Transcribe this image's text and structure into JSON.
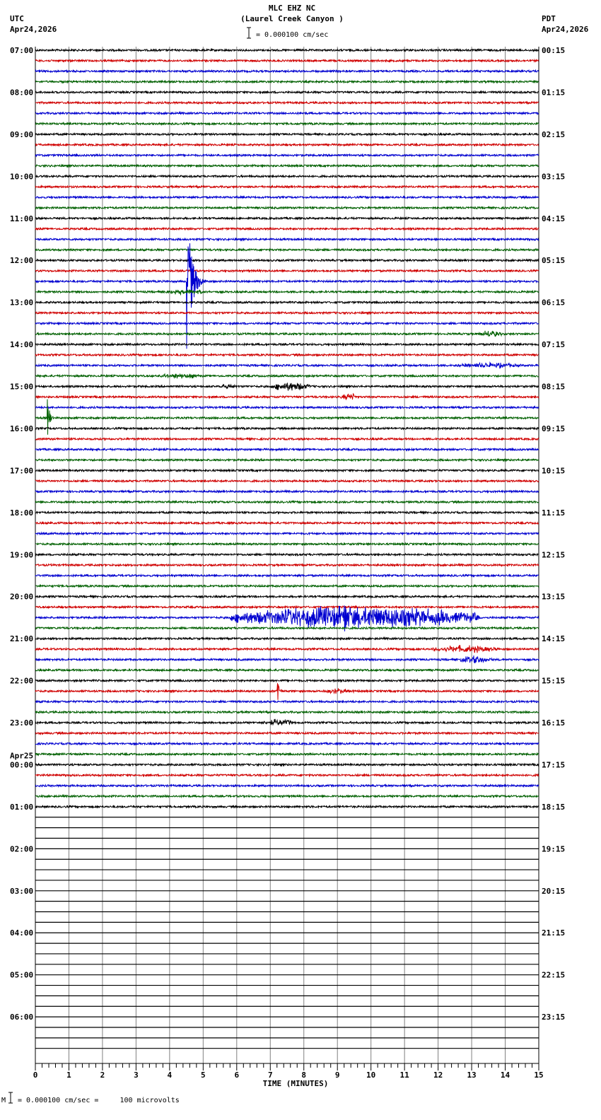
{
  "header": {
    "station": "MLC EHZ NC",
    "location": "(Laurel Creek Canyon )",
    "scale": "= 0.000100 cm/sec",
    "left_tz": "UTC",
    "left_date": "Apr24,2026",
    "right_tz": "PDT",
    "right_date": "Apr24,2026"
  },
  "footer": {
    "scale_note": "= 0.000100 cm/sec =     100 microvolts",
    "marker": "M"
  },
  "chart_data": {
    "type": "line",
    "title": "MLC EHZ NC (Laurel Creek Canyon )",
    "xlabel": "TIME (MINUTES)",
    "xlim": [
      0,
      15
    ],
    "x_ticks": [
      "0",
      "1",
      "2",
      "3",
      "4",
      "5",
      "6",
      "7",
      "8",
      "9",
      "10",
      "11",
      "12",
      "13",
      "14",
      "15"
    ],
    "traces_total": 96,
    "traces_with_data": 73,
    "trace_colors": [
      "#000000",
      "#d00000",
      "#0000d0",
      "#006000"
    ],
    "grid_color": "#808080",
    "left_labels": [
      {
        "row": 0,
        "text": "07:00"
      },
      {
        "row": 4,
        "text": "08:00"
      },
      {
        "row": 8,
        "text": "09:00"
      },
      {
        "row": 12,
        "text": "10:00"
      },
      {
        "row": 16,
        "text": "11:00"
      },
      {
        "row": 20,
        "text": "12:00"
      },
      {
        "row": 24,
        "text": "13:00"
      },
      {
        "row": 28,
        "text": "14:00"
      },
      {
        "row": 32,
        "text": "15:00"
      },
      {
        "row": 36,
        "text": "16:00"
      },
      {
        "row": 40,
        "text": "17:00"
      },
      {
        "row": 44,
        "text": "18:00"
      },
      {
        "row": 48,
        "text": "19:00"
      },
      {
        "row": 52,
        "text": "20:00"
      },
      {
        "row": 56,
        "text": "21:00"
      },
      {
        "row": 60,
        "text": "22:00"
      },
      {
        "row": 64,
        "text": "23:00"
      },
      {
        "row": 68,
        "text": "00:00",
        "date": "Apr25"
      },
      {
        "row": 72,
        "text": "01:00"
      },
      {
        "row": 76,
        "text": "02:00"
      },
      {
        "row": 80,
        "text": "03:00"
      },
      {
        "row": 84,
        "text": "04:00"
      },
      {
        "row": 88,
        "text": "05:00"
      },
      {
        "row": 92,
        "text": "06:00"
      }
    ],
    "right_labels": [
      {
        "row": 0,
        "text": "00:15"
      },
      {
        "row": 4,
        "text": "01:15"
      },
      {
        "row": 8,
        "text": "02:15"
      },
      {
        "row": 12,
        "text": "03:15"
      },
      {
        "row": 16,
        "text": "04:15"
      },
      {
        "row": 20,
        "text": "05:15"
      },
      {
        "row": 24,
        "text": "06:15"
      },
      {
        "row": 28,
        "text": "07:15"
      },
      {
        "row": 32,
        "text": "08:15"
      },
      {
        "row": 36,
        "text": "09:15"
      },
      {
        "row": 40,
        "text": "10:15"
      },
      {
        "row": 44,
        "text": "11:15"
      },
      {
        "row": 48,
        "text": "12:15"
      },
      {
        "row": 52,
        "text": "13:15"
      },
      {
        "row": 56,
        "text": "14:15"
      },
      {
        "row": 60,
        "text": "15:15"
      },
      {
        "row": 64,
        "text": "16:15"
      },
      {
        "row": 68,
        "text": "17:15"
      },
      {
        "row": 72,
        "text": "18:15"
      },
      {
        "row": 76,
        "text": "19:15"
      },
      {
        "row": 80,
        "text": "20:15"
      },
      {
        "row": 84,
        "text": "21:15"
      },
      {
        "row": 88,
        "text": "22:15"
      },
      {
        "row": 92,
        "text": "23:15"
      }
    ],
    "events": [
      {
        "row": 22,
        "start": 4.5,
        "end": 5.4,
        "amp": 110,
        "type": "spike"
      },
      {
        "row": 23,
        "start": 3.8,
        "end": 5.2,
        "amp": 3,
        "type": "burst"
      },
      {
        "row": 27,
        "start": 13.2,
        "end": 13.9,
        "amp": 4,
        "type": "burst"
      },
      {
        "row": 30,
        "start": 12.5,
        "end": 14.5,
        "amp": 3,
        "type": "burst"
      },
      {
        "row": 31,
        "start": 3.6,
        "end": 5.0,
        "amp": 3,
        "type": "burst"
      },
      {
        "row": 32,
        "start": 7.0,
        "end": 8.2,
        "amp": 5,
        "type": "burst"
      },
      {
        "row": 32,
        "start": 5.5,
        "end": 6.0,
        "amp": 3,
        "type": "burst"
      },
      {
        "row": 33,
        "start": 9.1,
        "end": 9.6,
        "amp": 4,
        "type": "burst"
      },
      {
        "row": 35,
        "start": 0.35,
        "end": 0.7,
        "amp": 40,
        "type": "spike"
      },
      {
        "row": 54,
        "start": 5.8,
        "end": 13.2,
        "amp": 12,
        "type": "burst"
      },
      {
        "row": 54,
        "start": 9.2,
        "end": 9.7,
        "amp": 40,
        "type": "spike"
      },
      {
        "row": 57,
        "start": 11.8,
        "end": 13.8,
        "amp": 4,
        "type": "burst"
      },
      {
        "row": 58,
        "start": 12.6,
        "end": 13.6,
        "amp": 4,
        "type": "burst"
      },
      {
        "row": 61,
        "start": 7.2,
        "end": 7.5,
        "amp": 35,
        "type": "spike"
      },
      {
        "row": 61,
        "start": 8.5,
        "end": 9.5,
        "amp": 3,
        "type": "burst"
      },
      {
        "row": 64,
        "start": 6.8,
        "end": 7.7,
        "amp": 4,
        "type": "burst"
      }
    ]
  }
}
